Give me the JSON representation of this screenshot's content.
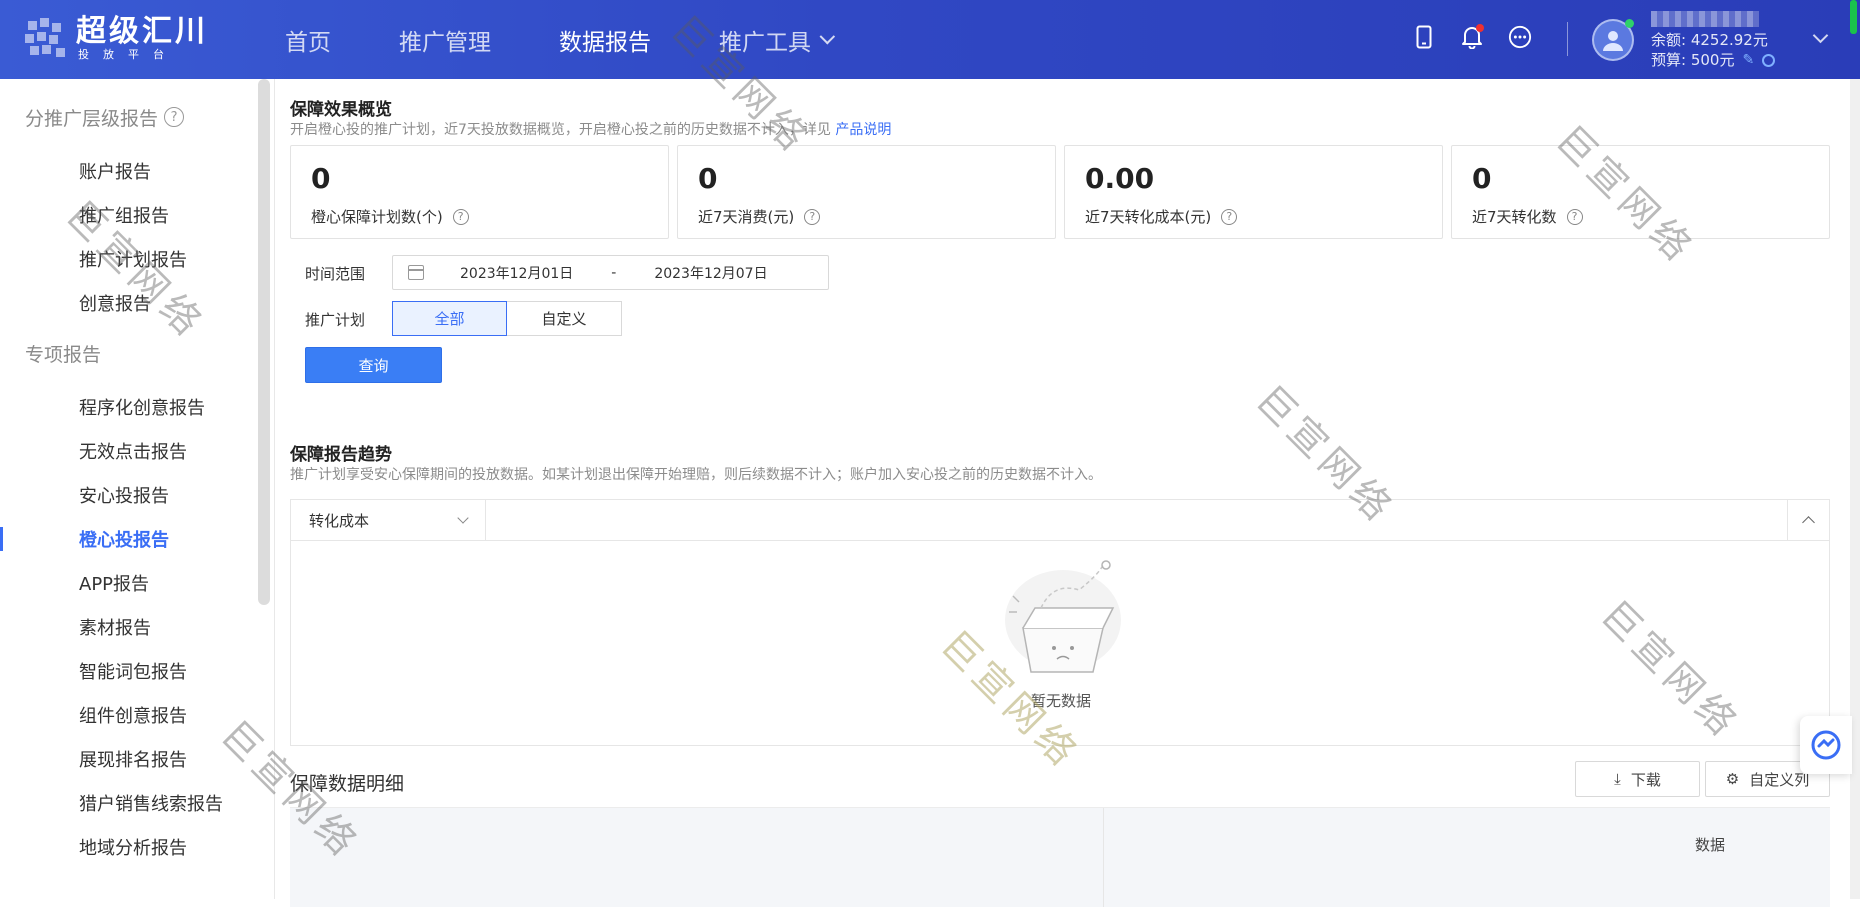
{
  "logo": {
    "title": "超级汇川",
    "subtitle": "投放平台"
  },
  "nav": {
    "home": "首页",
    "promo": "推广管理",
    "report": "数据报告",
    "tools": "推广工具"
  },
  "user": {
    "balance": "余额: 4252.92元",
    "budget": "预算: 500元"
  },
  "sidebar": {
    "group1": "分推广层级报告",
    "group1_items": [
      "账户报告",
      "推广组报告",
      "推广计划报告",
      "创意报告"
    ],
    "group2": "专项报告",
    "group2_items": [
      "程序化创意报告",
      "无效点击报告",
      "安心投报告",
      "橙心投报告",
      "APP报告",
      "素材报告",
      "智能词包报告",
      "组件创意报告",
      "展现排名报告",
      "猎户销售线索报告",
      "地域分析报告"
    ],
    "active_item": "橙心投报告"
  },
  "overview": {
    "title": "保障效果概览",
    "desc": "开启橙心投的推广计划，近7天投放数据概览，开启橙心投之前的历史数据不计入，详见",
    "link": "产品说明",
    "cards": [
      {
        "value": "0",
        "label": "橙心保障计划数(个)"
      },
      {
        "value": "0",
        "label": "近7天消费(元)"
      },
      {
        "value": "0.00",
        "label": "近7天转化成本(元)"
      },
      {
        "value": "0",
        "label": "近7天转化数"
      }
    ]
  },
  "filter": {
    "time_label": "时间范围",
    "start_date": "2023年12月01日",
    "date_sep": "-",
    "end_date": "2023年12月07日",
    "plan_label": "推广计划",
    "plan_all": "全部",
    "plan_custom": "自定义",
    "query": "查询"
  },
  "trend": {
    "title": "保障报告趋势",
    "desc": "推广计划享受安心保障期间的投放数据。如某计划退出保障开始理赔，则后续数据不计入；账户加入安心投之前的历史数据不计入。",
    "metric": "转化成本",
    "empty": "暂无数据"
  },
  "detail": {
    "title": "保障数据明细",
    "download": "下载",
    "custom_cols": "自定义列",
    "col_data": "数据"
  },
  "watermark": "巨宣网络",
  "colors": {
    "primary": "#3a6ef5",
    "header": "#3048c4"
  }
}
